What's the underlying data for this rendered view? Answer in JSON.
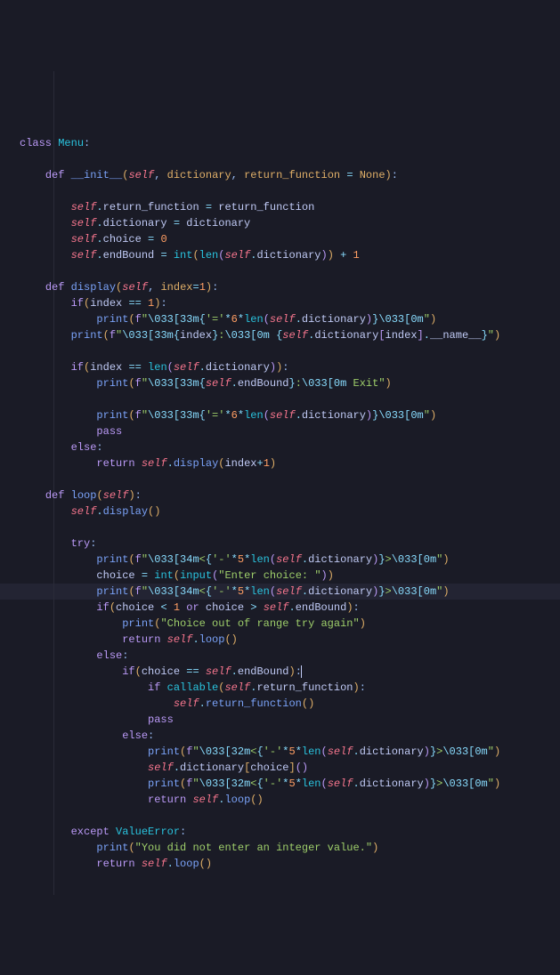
{
  "language": "python",
  "theme": "tokyo-night-dark",
  "active_line": 33,
  "code": {
    "class_name": "Menu",
    "methods": [
      {
        "name": "__init__",
        "params": [
          "self",
          "dictionary",
          "return_function = None"
        ],
        "body_lines": [
          "self.return_function = return_function",
          "self.dictionary = dictionary",
          "self.choice = 0",
          "self.endBound = int(len(self.dictionary)) + 1"
        ]
      },
      {
        "name": "display",
        "params": [
          "self",
          "index=1"
        ],
        "body_lines": [
          "if(index == 1):",
          "    print(f\"\\033[33m{'='*6*len(self.dictionary)}\\033[0m\")",
          "print(f\"\\033[33m{index}:\\033[0m {self.dictionary[index].__name__}\")",
          "",
          "if(index == len(self.dictionary)):",
          "    print(f\"\\033[33m{self.endBound}:\\033[0m Exit\")",
          "",
          "    print(f\"\\033[33m{'='*6*len(self.dictionary)}\\033[0m\")",
          "    pass",
          "else:",
          "    return self.display(index+1)"
        ]
      },
      {
        "name": "loop",
        "params": [
          "self"
        ],
        "body_lines": [
          "self.display()",
          "",
          "try:",
          "    print(f\"\\033[34m<{'-'*5*len(self.dictionary)}>\\033[0m\")",
          "    choice = int(input(\"Enter choice: \"))",
          "    print(f\"\\033[34m<{'-'*5*len(self.dictionary)}>\\033[0m\")",
          "    if(choice < 1 or choice > self.endBound):",
          "        print(\"Choice out of range try again\")",
          "        return self.loop()",
          "    else:",
          "        if(choice == self.endBound):",
          "            if callable(self.return_function):",
          "                self.return_function()",
          "            pass",
          "        else:",
          "            print(f\"\\033[32m<{'-'*5*len(self.dictionary)}>\\033[0m\")",
          "            self.dictionary[choice]()",
          "            print(f\"\\033[32m<{'-'*5*len(self.dictionary)}>\\033[0m\")",
          "            return self.loop()",
          "",
          "except ValueError:",
          "    print(\"You did not enter an integer value.\")",
          "    return self.loop()"
        ]
      }
    ]
  },
  "strings": {
    "esc33": "\\033[33m",
    "esc34": "\\033[34m",
    "esc32": "\\033[32m",
    "esc0": "\\033[0m",
    "exit": " Exit",
    "enter_choice": "Enter choice: ",
    "out_of_range": "Choice out of range try again",
    "not_integer": "You did not enter an integer value."
  }
}
